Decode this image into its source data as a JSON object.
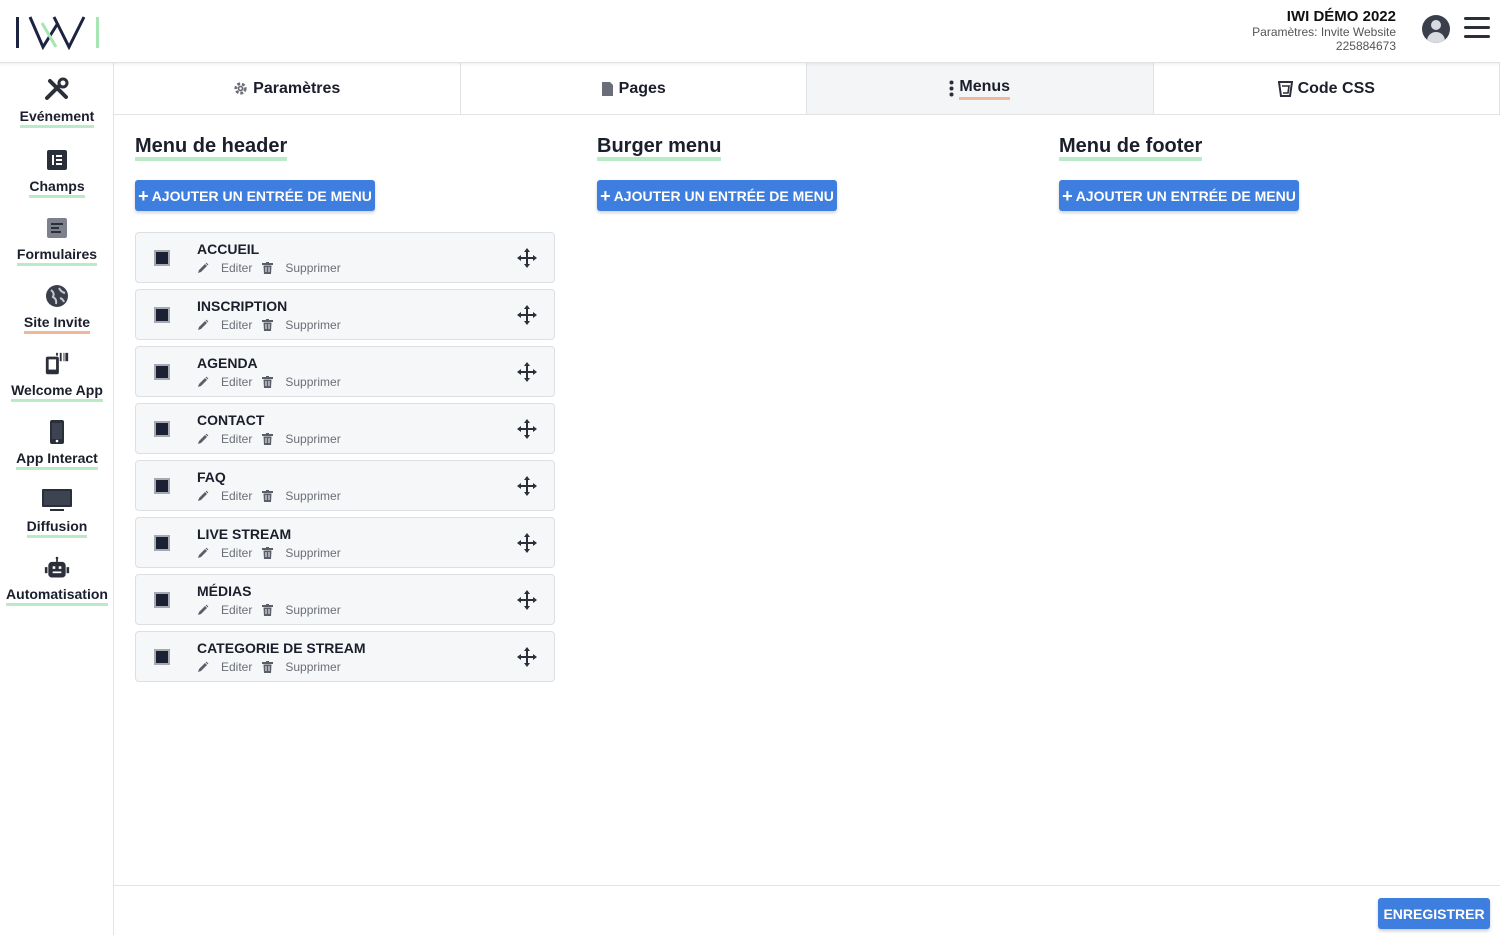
{
  "header": {
    "logo_text": "IWI",
    "event_title": "IWI DÉMO 2022",
    "event_subtitle": "Paramètres: Invite Website",
    "event_id": "225884673"
  },
  "sidebar": {
    "items": [
      {
        "label": "Evénement",
        "icon": "tools-icon"
      },
      {
        "label": "Champs",
        "icon": "fields-icon"
      },
      {
        "label": "Formulaires",
        "icon": "form-icon"
      },
      {
        "label": "Site Invite",
        "icon": "globe-icon"
      },
      {
        "label": "Welcome App",
        "icon": "scanner-icon"
      },
      {
        "label": "App Interact",
        "icon": "phone-icon"
      },
      {
        "label": "Diffusion",
        "icon": "monitor-icon"
      },
      {
        "label": "Automatisation",
        "icon": "robot-icon"
      }
    ]
  },
  "tabs": [
    {
      "label": "Paramètres",
      "icon": "gear-icon"
    },
    {
      "label": "Pages",
      "icon": "file-icon"
    },
    {
      "label": "Menus",
      "icon": "menu-dots-icon",
      "active": true
    },
    {
      "label": "Code CSS",
      "icon": "css-icon"
    }
  ],
  "columns": {
    "header_menu": {
      "title": "Menu de header",
      "add_label": "AJOUTER UN ENTRÉE DE MENU"
    },
    "burger_menu": {
      "title": "Burger menu",
      "add_label": "AJOUTER UN ENTRÉE DE MENU"
    },
    "footer_menu": {
      "title": "Menu de footer",
      "add_label": "AJOUTER UN ENTRÉE DE MENU"
    }
  },
  "menu_items": [
    {
      "name": "ACCUEIL",
      "edit": "Editer",
      "delete": "Supprimer"
    },
    {
      "name": "INSCRIPTION",
      "edit": "Editer",
      "delete": "Supprimer"
    },
    {
      "name": "AGENDA",
      "edit": "Editer",
      "delete": "Supprimer"
    },
    {
      "name": "CONTACT",
      "edit": "Editer",
      "delete": "Supprimer"
    },
    {
      "name": "FAQ",
      "edit": "Editer",
      "delete": "Supprimer"
    },
    {
      "name": "LIVE STREAM",
      "edit": "Editer",
      "delete": "Supprimer"
    },
    {
      "name": "MÉDIAS",
      "edit": "Editer",
      "delete": "Supprimer"
    },
    {
      "name": "CATEGORIE DE STREAM",
      "edit": "Editer",
      "delete": "Supprimer"
    }
  ],
  "footer": {
    "save_label": "ENREGISTRER"
  },
  "colors": {
    "accent": "#3d7ede",
    "underline_green": "#b9ecc6",
    "underline_orange": "#f1b79a",
    "dark": "#1b1e2b"
  }
}
